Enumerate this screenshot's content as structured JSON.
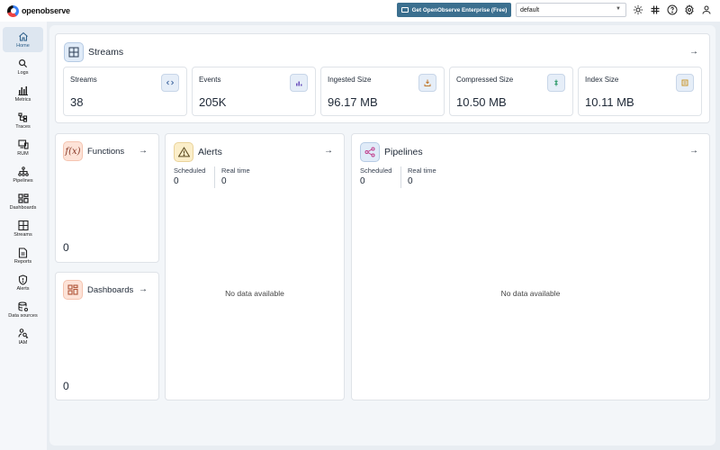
{
  "app": {
    "logo_text": "openobserve"
  },
  "header": {
    "enterprise_label": "Get OpenObserve Enterprise (Free)",
    "org_value": "default"
  },
  "sidebar": {
    "items": [
      {
        "label": "Home",
        "icon": "home-icon",
        "active": true
      },
      {
        "label": "Logs",
        "icon": "search-icon"
      },
      {
        "label": "Metrics",
        "icon": "bar-chart-icon"
      },
      {
        "label": "Traces",
        "icon": "traces-icon"
      },
      {
        "label": "RUM",
        "icon": "rum-icon"
      },
      {
        "label": "Pipelines",
        "icon": "pipelines-icon"
      },
      {
        "label": "Dashboards",
        "icon": "dashboards-icon"
      },
      {
        "label": "Streams",
        "icon": "streams-icon"
      },
      {
        "label": "Reports",
        "icon": "reports-icon"
      },
      {
        "label": "Alerts",
        "icon": "alerts-icon"
      },
      {
        "label": "Data sources",
        "icon": "data-sources-icon"
      },
      {
        "label": "IAM",
        "icon": "iam-icon"
      }
    ]
  },
  "streams_section": {
    "title": "Streams",
    "stats": [
      {
        "label": "Streams",
        "value": "38",
        "icon": "code-icon"
      },
      {
        "label": "Events",
        "value": "205K",
        "icon": "chart-icon"
      },
      {
        "label": "Ingested Size",
        "value": "96.17 MB",
        "icon": "ingest-icon"
      },
      {
        "label": "Compressed Size",
        "value": "10.50 MB",
        "icon": "compress-icon"
      },
      {
        "label": "Index Size",
        "value": "10.11 MB",
        "icon": "index-icon"
      }
    ]
  },
  "functions": {
    "title": "Functions",
    "count": "0"
  },
  "dashboards": {
    "title": "Dashboards",
    "count": "0"
  },
  "alerts": {
    "title": "Alerts",
    "scheduled_label": "Scheduled",
    "scheduled_value": "0",
    "realtime_label": "Real time",
    "realtime_value": "0",
    "empty_text": "No data available"
  },
  "pipelines": {
    "title": "Pipelines",
    "scheduled_label": "Scheduled",
    "scheduled_value": "0",
    "realtime_label": "Real time",
    "realtime_value": "0",
    "empty_text": "No data available"
  },
  "colors": {
    "accent": "#3b6f8f",
    "functions_tint": "#fde3d8",
    "alerts_tint": "#fbeec9",
    "pipelines_tint": "#e0ebf8"
  }
}
